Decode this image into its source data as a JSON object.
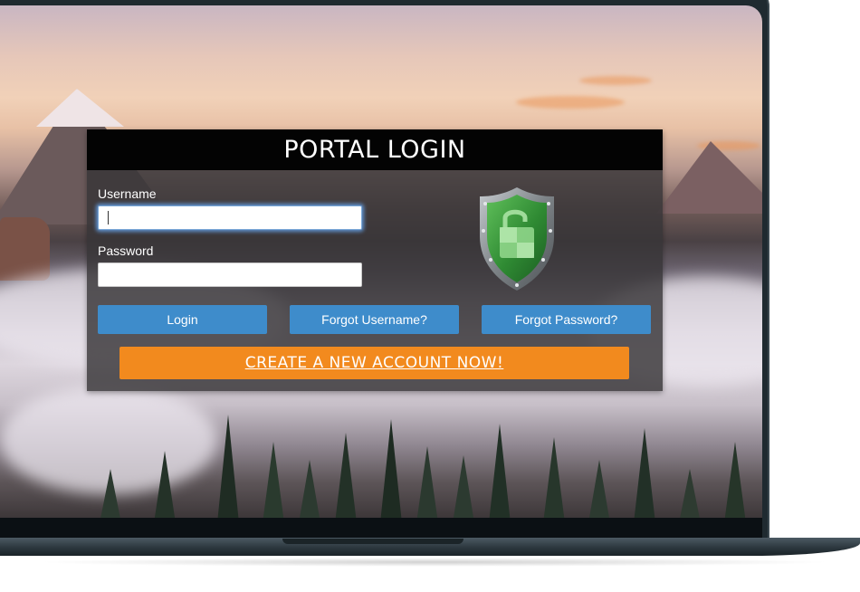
{
  "portal": {
    "title": "PORTAL LOGIN",
    "username_label": "Username",
    "username_value": "",
    "password_label": "Password",
    "password_value": ""
  },
  "buttons": {
    "login": "Login",
    "forgot_username": "Forgot Username?",
    "forgot_password": "Forgot Password?",
    "create_account": "CREATE A NEW ACCOUNT NOW!"
  },
  "icons": {
    "shield": "padlock-shield-icon"
  },
  "colors": {
    "header_bg": "#030303",
    "panel_bg": "#373537",
    "button_blue": "#3e8ccb",
    "button_orange": "#f28a1e",
    "shield_green": "#3f9b3f",
    "shield_rim": "#8a8f93"
  }
}
